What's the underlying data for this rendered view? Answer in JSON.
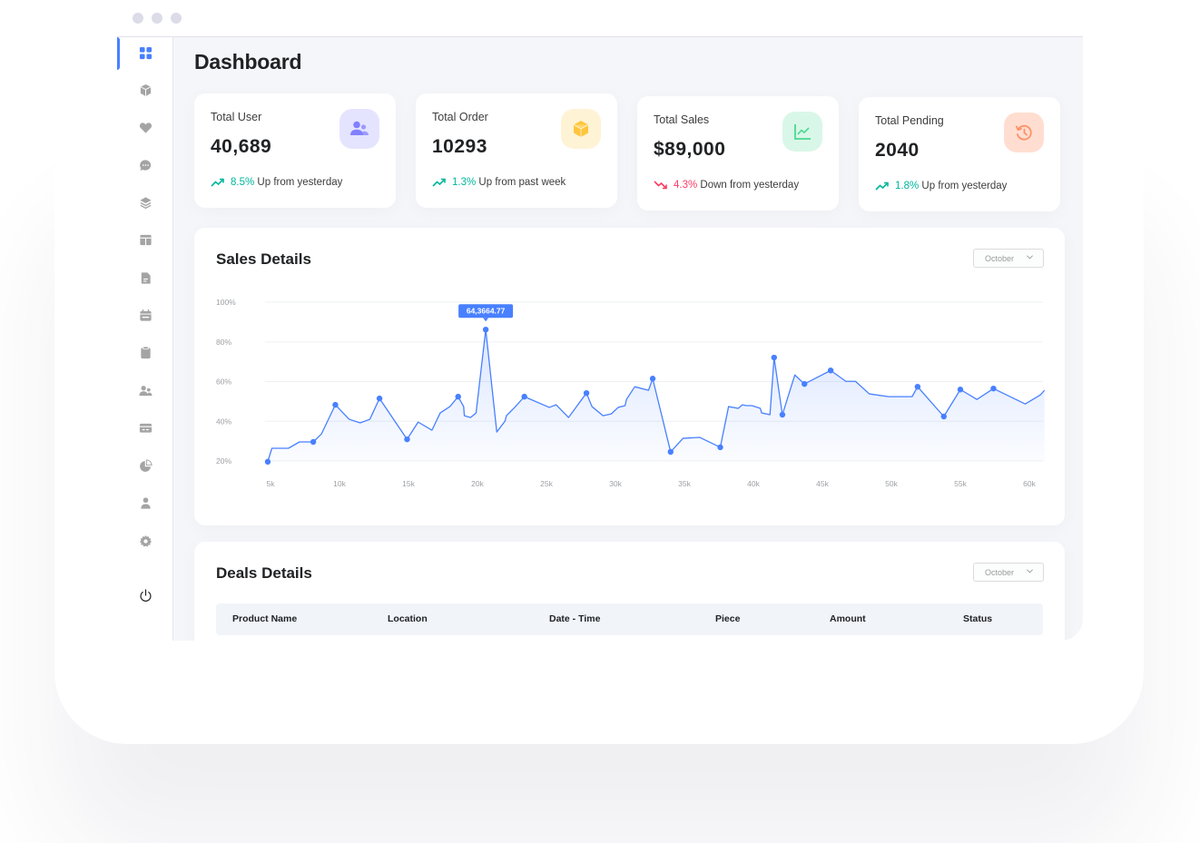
{
  "window": {
    "traffic_lights": [
      "close",
      "minimize",
      "maximize"
    ]
  },
  "sidebar": {
    "items": [
      {
        "name": "dashboard",
        "icon": "grid-icon",
        "active": true
      },
      {
        "name": "products",
        "icon": "cube-icon",
        "active": false
      },
      {
        "name": "favorites",
        "icon": "heart-icon",
        "active": false
      },
      {
        "name": "inbox",
        "icon": "chat-icon",
        "active": false
      },
      {
        "name": "order-lists",
        "icon": "layers-icon",
        "active": false
      },
      {
        "name": "product-stock",
        "icon": "table-icon",
        "active": false
      },
      {
        "name": "pricing",
        "icon": "document-icon",
        "active": false
      },
      {
        "name": "calendar",
        "icon": "calendar-icon",
        "active": false
      },
      {
        "name": "todo",
        "icon": "clipboard-icon",
        "active": false
      },
      {
        "name": "contact",
        "icon": "users-icon",
        "active": false
      },
      {
        "name": "invoice",
        "icon": "credit-card-icon",
        "active": false
      },
      {
        "name": "ui-elements",
        "icon": "pie-chart-icon",
        "active": false
      },
      {
        "name": "team",
        "icon": "user-icon",
        "active": false
      },
      {
        "name": "settings",
        "icon": "gear-icon",
        "active": false
      },
      {
        "name": "logout",
        "icon": "power-icon",
        "active": false
      }
    ]
  },
  "header": {
    "title": "Dashboard"
  },
  "stats": [
    {
      "label": "Total User",
      "value": "40,689",
      "change": "8.5%",
      "change_text": "Up from yesterday",
      "direction": "up",
      "icon": "users-icon",
      "icon_bg": "#e5e4ff",
      "icon_color": "#8280ff"
    },
    {
      "label": "Total Order",
      "value": "10293",
      "change": "1.3%",
      "change_text": "Up from past week",
      "direction": "up",
      "icon": "box-icon",
      "icon_bg": "#fff3d6",
      "icon_color": "#fec53d"
    },
    {
      "label": "Total Sales",
      "value": "$89,000",
      "change": "4.3%",
      "change_text": "Down from yesterday",
      "direction": "down",
      "icon": "line-chart-icon",
      "icon_bg": "#d9f7e8",
      "icon_color": "#4ad991"
    },
    {
      "label": "Total Pending",
      "value": "2040",
      "change": "1.8%",
      "change_text": "Up from yesterday",
      "direction": "up",
      "icon": "history-icon",
      "icon_bg": "#ffded1",
      "icon_color": "#ff9066"
    }
  ],
  "colors": {
    "accent": "#4880ff",
    "up": "#00b69b",
    "down": "#f93c65"
  },
  "sales": {
    "title": "Sales Details",
    "month": "October"
  },
  "deals": {
    "title": "Deals Details",
    "month": "October",
    "columns": [
      "Product Name",
      "Location",
      "Date - Time",
      "Piece",
      "Amount",
      "Status"
    ]
  },
  "chart_data": {
    "type": "area",
    "title": "Sales Details",
    "xlabel": "",
    "ylabel": "",
    "x_ticks": [
      "5k",
      "10k",
      "15k",
      "20k",
      "25k",
      "30k",
      "35k",
      "40k",
      "45k",
      "50k",
      "55k",
      "60k"
    ],
    "y_ticks": [
      "20%",
      "40%",
      "60%",
      "80%",
      "100%"
    ],
    "xlim": [
      5,
      60
    ],
    "ylim": [
      20,
      100
    ],
    "grid": true,
    "tooltip": {
      "x": 20.6,
      "y": 86.2,
      "label": "64,3664.77"
    },
    "series": [
      {
        "name": "Sales",
        "color": "#4880ff",
        "points": [
          [
            4.8,
            19.6,
            1
          ],
          [
            5.1,
            26.4,
            0
          ],
          [
            6.3,
            26.4,
            0
          ],
          [
            7.1,
            29.6,
            0
          ],
          [
            8.1,
            29.6,
            1
          ],
          [
            8.7,
            33.7,
            0
          ],
          [
            9.7,
            48.3,
            1
          ],
          [
            10.7,
            41.0,
            0
          ],
          [
            11.5,
            39.2,
            0
          ],
          [
            12.2,
            41.0,
            0
          ],
          [
            12.9,
            51.5,
            1
          ],
          [
            14.9,
            30.9,
            1
          ],
          [
            15.7,
            39.6,
            0
          ],
          [
            16.7,
            35.5,
            0
          ],
          [
            17.3,
            44.2,
            0
          ],
          [
            18.0,
            47.4,
            0
          ],
          [
            18.6,
            52.4,
            1
          ],
          [
            19.0,
            47.4,
            0
          ],
          [
            19.05,
            42.8,
            0
          ],
          [
            19.5,
            41.9,
            0
          ],
          [
            19.9,
            44.2,
            0
          ],
          [
            20.6,
            86.2,
            1
          ],
          [
            21.4,
            34.6,
            0
          ],
          [
            22.0,
            40.1,
            0
          ],
          [
            22.1,
            42.8,
            0
          ],
          [
            22.7,
            47.0,
            0
          ],
          [
            23.4,
            52.4,
            1
          ],
          [
            25.2,
            47.0,
            0
          ],
          [
            25.7,
            48.3,
            0
          ],
          [
            26.6,
            41.9,
            0
          ],
          [
            27.9,
            54.2,
            1
          ],
          [
            28.3,
            47.4,
            0
          ],
          [
            29.1,
            42.8,
            0
          ],
          [
            29.7,
            43.7,
            0
          ],
          [
            30.2,
            47.0,
            0
          ],
          [
            30.7,
            47.9,
            0
          ],
          [
            30.8,
            51.0,
            0
          ],
          [
            31.4,
            57.4,
            0
          ],
          [
            32.4,
            55.6,
            0
          ],
          [
            32.7,
            61.5,
            1
          ],
          [
            34.0,
            24.6,
            1
          ],
          [
            34.9,
            31.4,
            0
          ],
          [
            36.1,
            31.9,
            0
          ],
          [
            37.6,
            26.9,
            1
          ],
          [
            38.2,
            47.4,
            0
          ],
          [
            38.9,
            46.5,
            0
          ],
          [
            39.2,
            48.3,
            0
          ],
          [
            39.5,
            47.9,
            0
          ],
          [
            39.9,
            47.9,
            0
          ],
          [
            40.5,
            46.5,
            0
          ],
          [
            40.6,
            44.2,
            0
          ],
          [
            41.2,
            43.3,
            0
          ],
          [
            41.5,
            72.1,
            1
          ],
          [
            42.1,
            43.3,
            1
          ],
          [
            43.0,
            63.3,
            0
          ],
          [
            43.7,
            58.8,
            1
          ],
          [
            45.6,
            65.6,
            1
          ],
          [
            46.7,
            60.1,
            0
          ],
          [
            47.4,
            60.1,
            0
          ],
          [
            48.4,
            53.8,
            0
          ],
          [
            49.8,
            52.4,
            0
          ],
          [
            51.5,
            52.4,
            0
          ],
          [
            51.9,
            57.4,
            1
          ],
          [
            53.8,
            42.4,
            1
          ],
          [
            55.0,
            56.0,
            1
          ],
          [
            56.2,
            51.0,
            0
          ],
          [
            57.4,
            56.5,
            1
          ],
          [
            59.7,
            48.7,
            0
          ],
          [
            60.8,
            53.3,
            0
          ],
          [
            61.1,
            55.6,
            0
          ]
        ]
      }
    ]
  }
}
